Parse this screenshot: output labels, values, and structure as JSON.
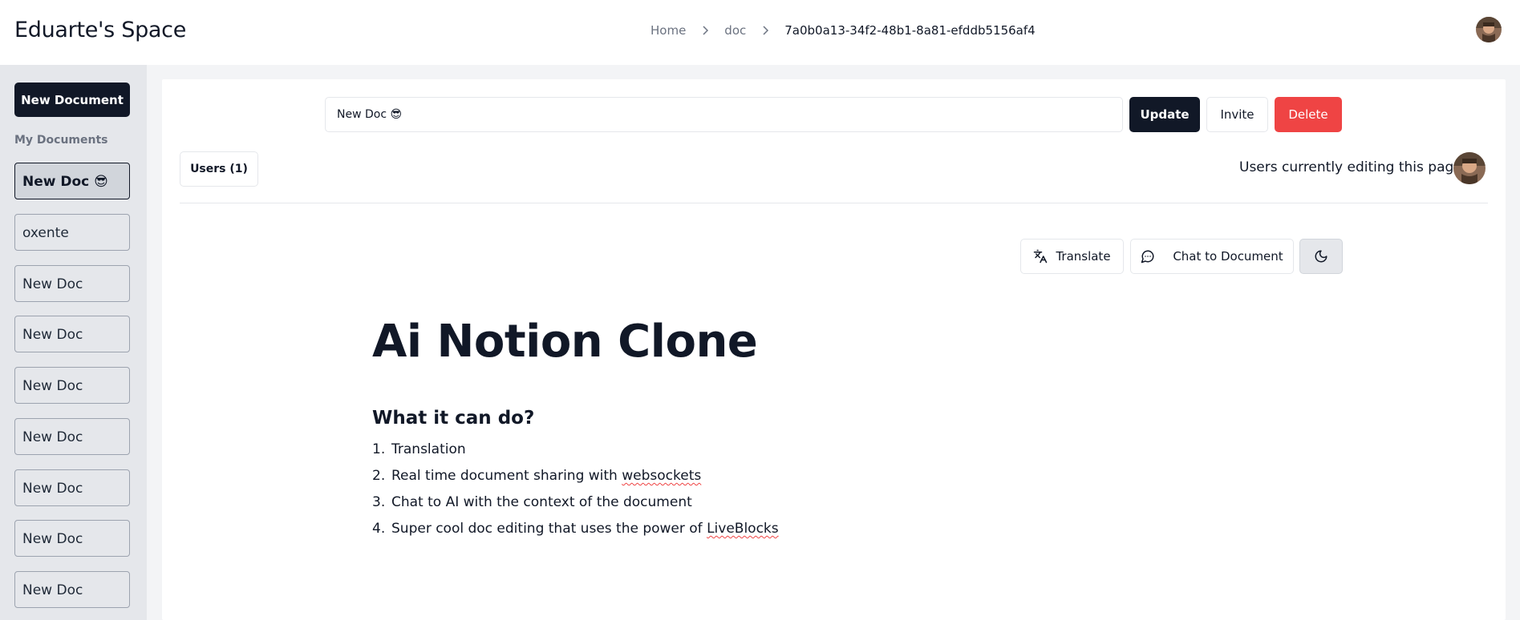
{
  "header": {
    "brand": "Eduarte's Space",
    "breadcrumb": {
      "home": "Home",
      "doc": "doc",
      "current": "7a0b0a13-34f2-48b1-8a81-efddb5156af4"
    },
    "avatar_icon": "user-avatar"
  },
  "sidebar": {
    "new_document_label": "New Document",
    "section_label": "My Documents",
    "items": [
      {
        "label": "New Doc 😎",
        "active": true
      },
      {
        "label": "oxente"
      },
      {
        "label": "New Doc"
      },
      {
        "label": "New Doc"
      },
      {
        "label": "New Doc"
      },
      {
        "label": "New Doc"
      },
      {
        "label": "New Doc"
      },
      {
        "label": "New Doc"
      },
      {
        "label": "New Doc"
      }
    ]
  },
  "toolbar": {
    "title_value": "New Doc 😎",
    "update_label": "Update",
    "invite_label": "Invite",
    "delete_label": "Delete",
    "users_label": "Users (1)",
    "editing_label": "Users currently editing this page",
    "translate_label": "Translate",
    "chat_label": "Chat to Document",
    "theme_icon": "moon-icon"
  },
  "document": {
    "title": "Ai Notion Clone",
    "subtitle": "What it can do?",
    "list": [
      {
        "num": "1.",
        "text": "Translation"
      },
      {
        "num": "2.",
        "text": "Real time document sharing with ",
        "flagged": "websockets"
      },
      {
        "num": "3.",
        "text": "Chat to AI with the context of the document"
      },
      {
        "num": "4.",
        "text": "Super cool doc editing that uses the power of ",
        "flagged": "LiveBlocks"
      }
    ]
  },
  "colors": {
    "primary": "#111827",
    "danger": "#ef4444",
    "sidebar_bg": "#e5e7eb",
    "page_bg": "#f3f4f6"
  }
}
